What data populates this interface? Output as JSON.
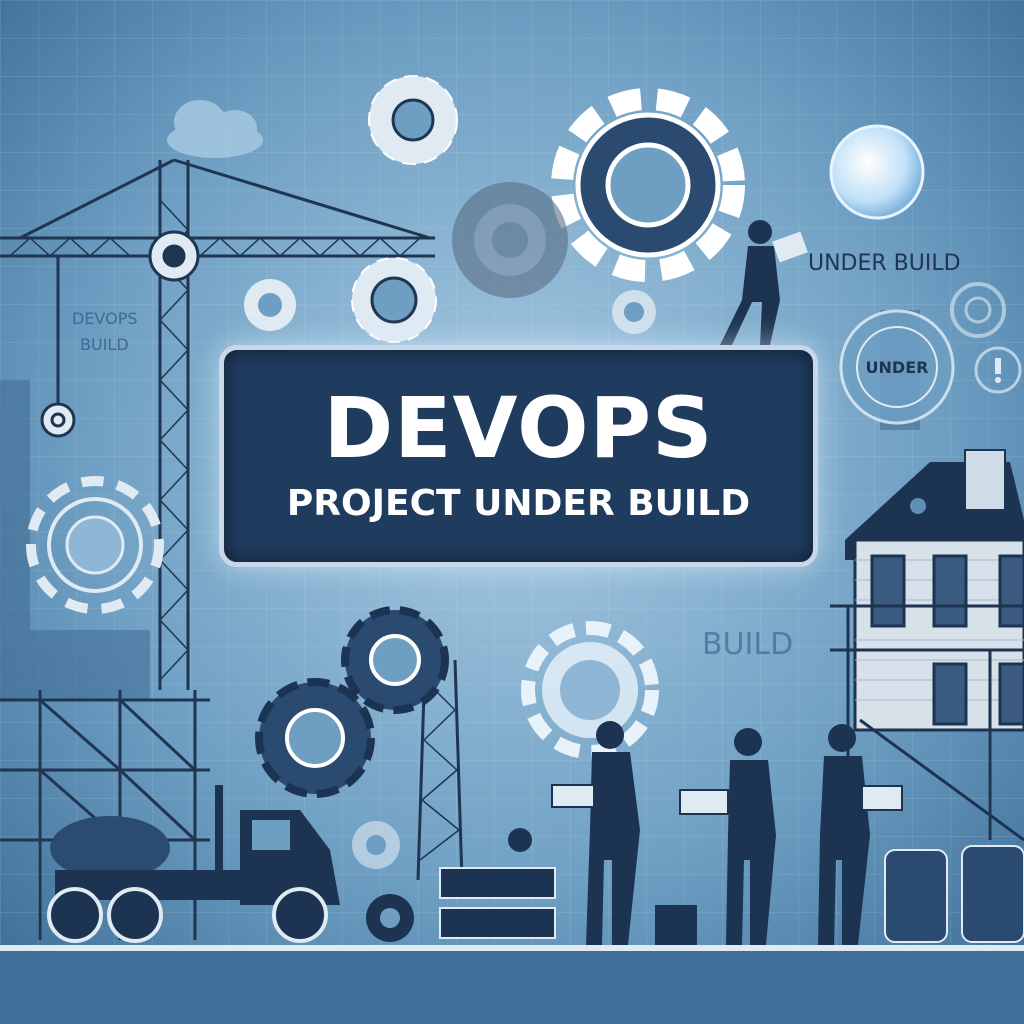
{
  "banner": {
    "title": "DEVOPS",
    "subtitle": "PROJECT UNDER BUILD"
  },
  "signs": {
    "under_build": "UNDER BUILD",
    "devops_line1": "DEVOPS",
    "devops_line2": "BUILD",
    "build": "BUILD",
    "badge": "UNDER"
  },
  "colors": {
    "background": "#5d8fb3",
    "banner_fill": "#1f3b5e",
    "banner_border": "#c9d8e8",
    "silhouette": "#1c3352",
    "gear_light": "#dfeaf3"
  }
}
